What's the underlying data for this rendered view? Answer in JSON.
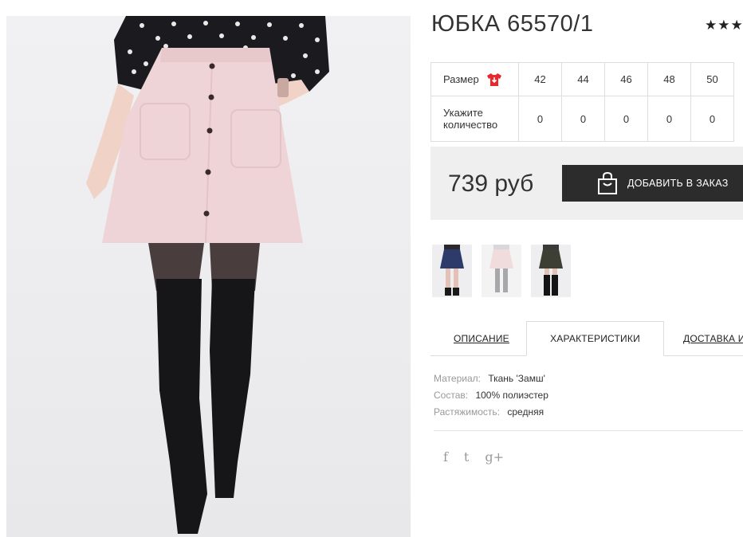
{
  "product": {
    "title": "ЮБКА 65570/1",
    "rating_stars": "★★★"
  },
  "sizes": {
    "size_label": "Размер",
    "quantity_label_line1": "Укажите",
    "quantity_label_line2": "количество",
    "values": [
      "42",
      "44",
      "46",
      "48",
      "50"
    ],
    "quantities": [
      "0",
      "0",
      "0",
      "0",
      "0"
    ]
  },
  "purchase": {
    "price": "739 руб",
    "add_to_order_label": "ДОБАВИТЬ В ЗАКАЗ"
  },
  "tabs": {
    "description": "ОПИСАНИЕ",
    "characteristics": "ХАРАКТЕРИСТИКИ",
    "delivery": "ДОСТАВКА И"
  },
  "specs": [
    {
      "key": "Материал:",
      "value": "Ткань 'Замш'"
    },
    {
      "key": "Состав:",
      "value": "100% полиэстер"
    },
    {
      "key": "Растяжимость:",
      "value": "средняя"
    }
  ],
  "social": {
    "facebook": "f",
    "twitter": "t",
    "google_plus": "g+"
  },
  "colors": {
    "accent_dark": "#2c2c2c",
    "price_bg": "#efefef",
    "tshirt_icon": "#e8282b",
    "skirt_pink": "#eed4d6"
  }
}
